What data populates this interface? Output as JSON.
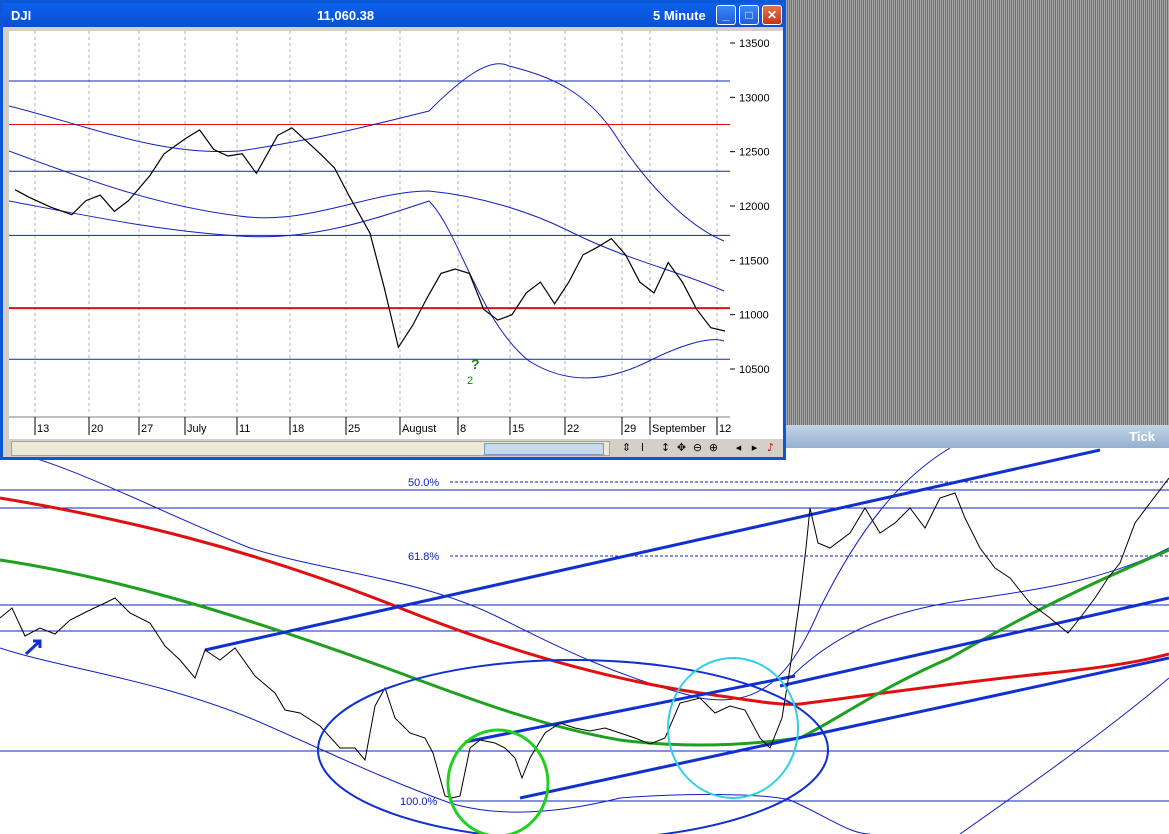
{
  "window": {
    "title": "DJI",
    "value": "11,060.38",
    "interval": "5 Minute",
    "buttons": [
      "minimize",
      "maximize",
      "close"
    ]
  },
  "tick_panel": {
    "label": "Tick"
  },
  "colors": {
    "ma_red": "#e01010",
    "ma_blue": "#1020c0",
    "ma_green": "#20a020",
    "ellipse_cyan": "#20d0e0",
    "title_blue": "#0a58d8"
  },
  "toolbar_icons": [
    "scale-icon",
    "cursor-icon",
    "vertical-move-icon",
    "move-icon",
    "zoom-out-icon",
    "zoom-in-icon",
    "scroll-left-icon",
    "scroll-right-icon",
    "bell-icon"
  ],
  "chart_data": [
    {
      "type": "line",
      "title": "",
      "y_ticks": [
        13500,
        13000,
        12500,
        12000,
        11500,
        11000,
        10500
      ],
      "ylim": [
        10000,
        13600
      ],
      "x_tick_labels": [
        "13",
        "20",
        "27",
        "July",
        "11",
        "18",
        "25",
        "August",
        "8",
        "15",
        "22",
        "29",
        "September",
        "12"
      ],
      "horizontal_levels": [
        {
          "value": 13150,
          "color": "blue"
        },
        {
          "value": 12750,
          "color": "red"
        },
        {
          "value": 12320,
          "color": "blue"
        },
        {
          "value": 11730,
          "color": "blue"
        },
        {
          "value": 11060,
          "color": "red-thick"
        },
        {
          "value": 10590,
          "color": "blue"
        }
      ],
      "annotations": [
        "?",
        "2"
      ],
      "price_series": {
        "name": "",
        "x": [
          0,
          0.02,
          0.05,
          0.08,
          0.1,
          0.12,
          0.14,
          0.16,
          0.19,
          0.21,
          0.24,
          0.26,
          0.28,
          0.3,
          0.32,
          0.34,
          0.37,
          0.39,
          0.41,
          0.43,
          0.45,
          0.47,
          0.5,
          0.52,
          0.54,
          0.56,
          0.58,
          0.6,
          0.62,
          0.64,
          0.66,
          0.68,
          0.7,
          0.72,
          0.74,
          0.76,
          0.78,
          0.8,
          0.82,
          0.84,
          0.86,
          0.88,
          0.9,
          0.92,
          0.94,
          0.96,
          0.98,
          1.0
        ],
        "y": [
          12150,
          12080,
          11990,
          11920,
          12050,
          12100,
          11950,
          12050,
          12280,
          12480,
          12620,
          12700,
          12520,
          12460,
          12480,
          12300,
          12650,
          12720,
          12600,
          12480,
          12350,
          12100,
          11750,
          11250,
          10700,
          10900,
          11150,
          11380,
          11420,
          11380,
          11050,
          10950,
          11000,
          11200,
          11300,
          11100,
          11300,
          11550,
          11620,
          11700,
          11550,
          11300,
          11200,
          11480,
          11300,
          11050,
          10880,
          10850
        ]
      }
    },
    {
      "type": "line",
      "title": "Tick",
      "fib_levels": [
        {
          "label": "50.0%",
          "value": 50.0
        },
        {
          "label": "61.8%",
          "value": 61.8
        },
        {
          "label": "100.0%",
          "value": 100.0
        }
      ],
      "lines": [
        {
          "name": "",
          "color": "red",
          "kind": "moving-average"
        },
        {
          "name": "",
          "color": "green",
          "kind": "moving-average"
        },
        {
          "name": "",
          "color": "blue",
          "kind": "channel"
        },
        {
          "name": "",
          "color": "black",
          "kind": "price"
        }
      ],
      "ellipses": [
        {
          "color": "blue"
        },
        {
          "color": "green"
        },
        {
          "color": "cyan"
        }
      ]
    }
  ]
}
